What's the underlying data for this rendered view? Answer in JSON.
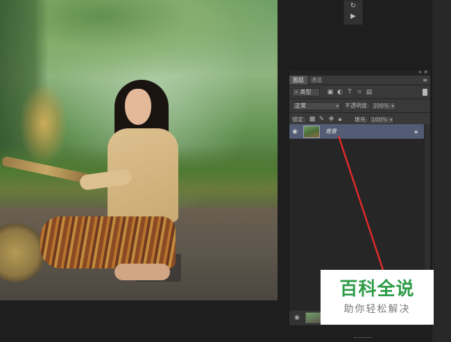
{
  "mini_toolbar": {
    "btn1": "↻",
    "btn2": "▶"
  },
  "panel": {
    "tabs": [
      "图层",
      "通道"
    ],
    "menu_icon": "≡",
    "collapse_icon": "»",
    "close_icon": "×",
    "filter": {
      "label": "类型",
      "search_icon": "⌕",
      "icons": [
        "image-filter-icon",
        "adjustment-filter-icon",
        "type-filter-icon",
        "shape-filter-icon",
        "smartobject-filter-icon"
      ]
    },
    "blend_mode": "正常",
    "opacity_label": "不透明度:",
    "opacity_value": "100%",
    "lock_label": "锁定:",
    "fill_label": "填充:",
    "fill_value": "100%",
    "layers": [
      {
        "name": "背景",
        "visible": true,
        "locked": true,
        "selected": true
      }
    ]
  },
  "watermark": {
    "title": "百科全说",
    "subtitle": "助你轻松解决",
    "color": "#2e9c48"
  },
  "annotation": {
    "color": "#e02b2b"
  }
}
